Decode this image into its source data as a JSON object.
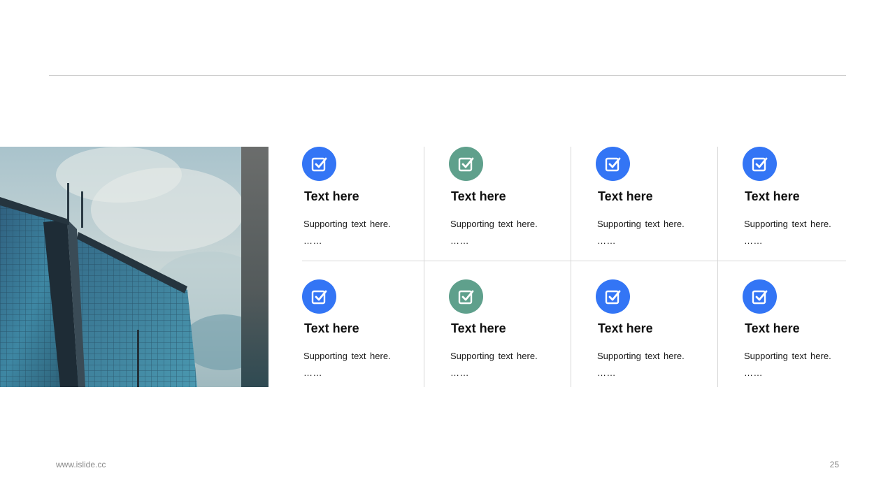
{
  "slide": {
    "footer_url": "www.islide.cc",
    "page_number": "25"
  },
  "colors": {
    "blue": "#3375f5",
    "green": "#5fa08c",
    "divider": "#d6d6d6"
  },
  "cards": [
    {
      "title": "Text here",
      "text": "Supporting text here.",
      "ellipsis": "……",
      "icon": "check-square-icon",
      "color": "blue"
    },
    {
      "title": "Text here",
      "text": "Supporting text here.",
      "ellipsis": "……",
      "icon": "check-square-icon",
      "color": "green"
    },
    {
      "title": "Text here",
      "text": "Supporting text here.",
      "ellipsis": "……",
      "icon": "check-square-icon",
      "color": "blue"
    },
    {
      "title": "Text here",
      "text": "Supporting text here.",
      "ellipsis": "……",
      "icon": "check-square-icon",
      "color": "blue"
    },
    {
      "title": "Text here",
      "text": "Supporting text here.",
      "ellipsis": "……",
      "icon": "check-square-icon",
      "color": "blue"
    },
    {
      "title": "Text here",
      "text": "Supporting text here.",
      "ellipsis": "……",
      "icon": "check-square-icon",
      "color": "green"
    },
    {
      "title": "Text here",
      "text": "Supporting text here.",
      "ellipsis": "……",
      "icon": "check-square-icon",
      "color": "blue"
    },
    {
      "title": "Text here",
      "text": "Supporting text here.",
      "ellipsis": "……",
      "icon": "check-square-icon",
      "color": "blue"
    }
  ]
}
